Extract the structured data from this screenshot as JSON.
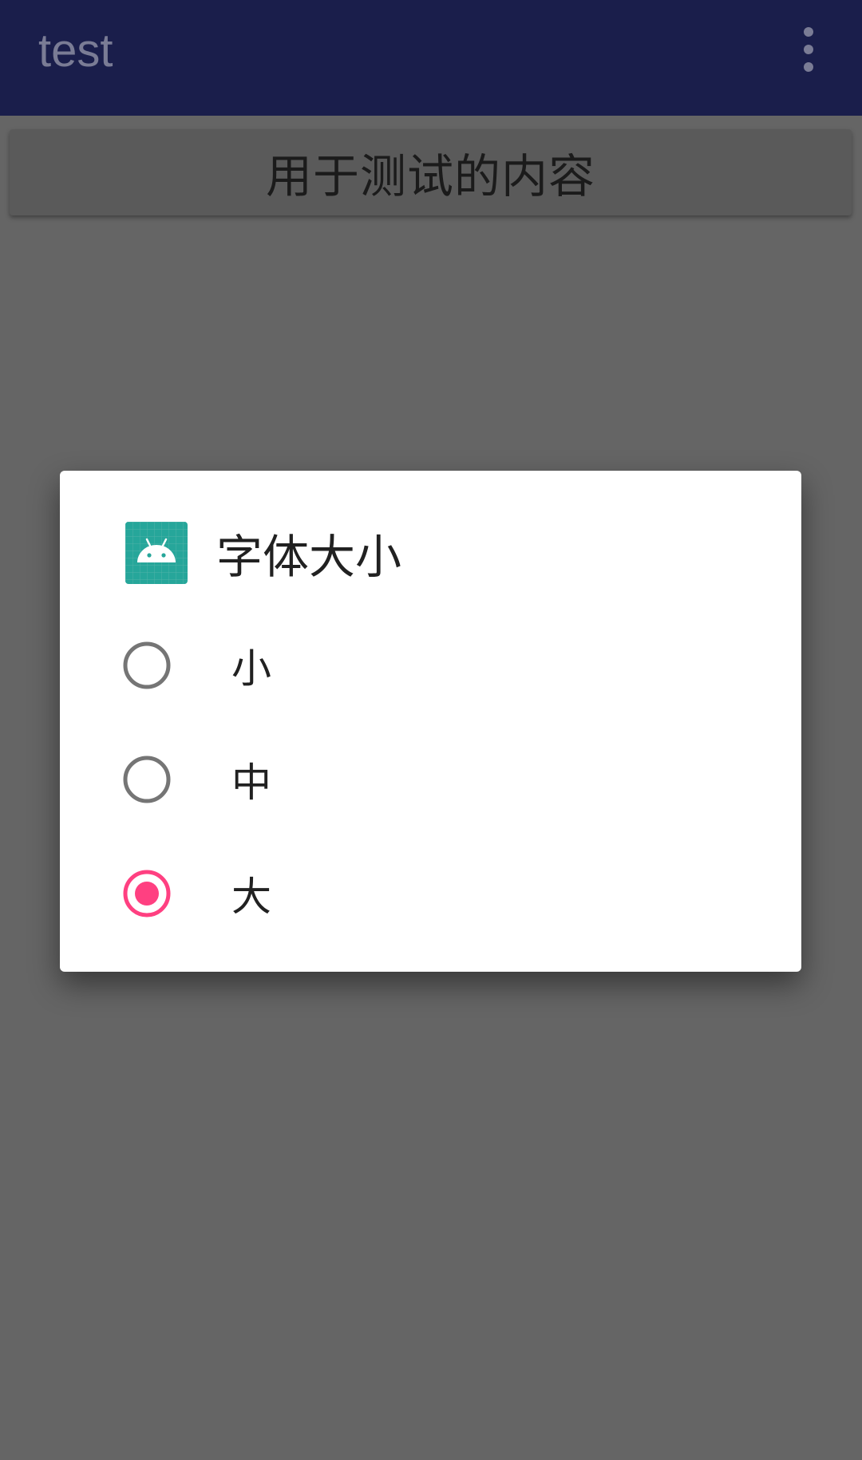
{
  "app_bar": {
    "title": "test",
    "overflow_icon": "more-vert-icon",
    "background_color": "#1a1e4b"
  },
  "main": {
    "content_button_label": "用于测试的内容"
  },
  "dialog": {
    "icon": "android-app-icon",
    "title": "字体大小",
    "options": [
      {
        "label": "小",
        "selected": false
      },
      {
        "label": "中",
        "selected": false
      },
      {
        "label": "大",
        "selected": true
      }
    ],
    "accent_color": "#ff4081",
    "unselected_color": "#757575"
  }
}
